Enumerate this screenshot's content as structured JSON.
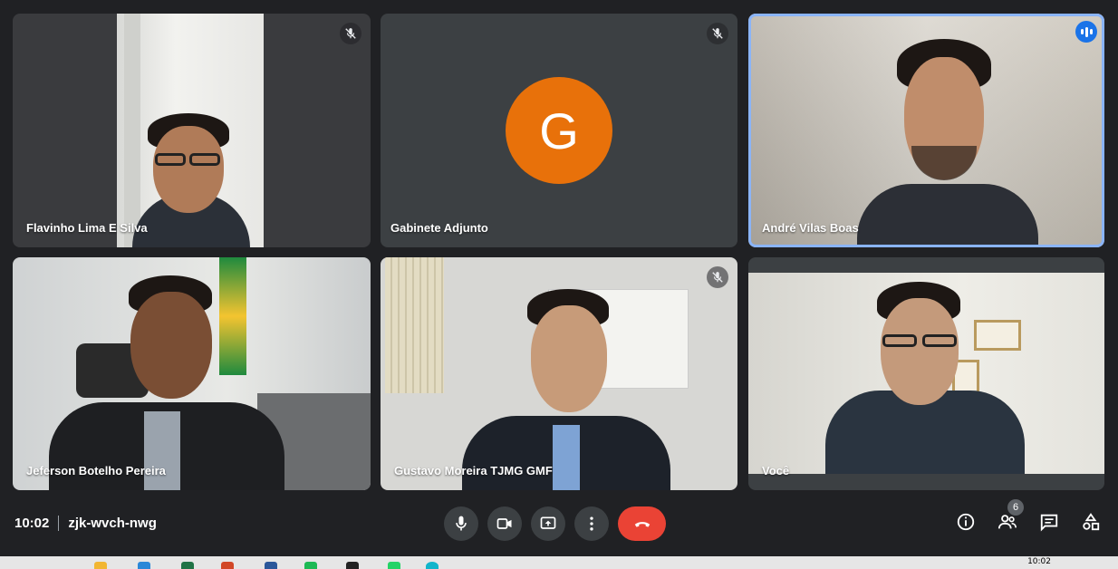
{
  "participants": [
    {
      "name": "Flavinho Lima E Silva",
      "muted": true
    },
    {
      "name": "Gabinete Adjunto",
      "muted": true,
      "avatar_letter": "G",
      "avatar_color": "#e8710a"
    },
    {
      "name": "André Vilas Boas",
      "muted": false,
      "speaking": true
    },
    {
      "name": "Jeferson Botelho Pereira",
      "muted": false
    },
    {
      "name": "Gustavo Moreira TJMG GMF",
      "muted": true
    },
    {
      "name": "Você",
      "muted": false
    }
  ],
  "bottom_bar": {
    "time": "10:02",
    "meeting_code": "zjk-wvch-nwg",
    "controls": [
      "mic-icon",
      "camera-icon",
      "present-screen-icon",
      "more-options-icon",
      "hang-up-icon"
    ],
    "right_controls": [
      "info-icon",
      "people-icon",
      "chat-icon",
      "activities-icon"
    ],
    "people_count": "6"
  },
  "taskbar": {
    "clock": "10:02"
  },
  "colors": {
    "background": "#202124",
    "tile": "#3c4043",
    "hang_up": "#ea4335",
    "speaking": "#1a73e8",
    "active_border": "#8ab4f8"
  }
}
